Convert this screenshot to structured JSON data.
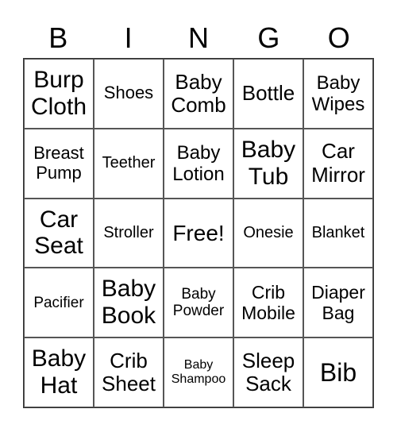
{
  "header": [
    "B",
    "I",
    "N",
    "G",
    "O"
  ],
  "cells": [
    "Burp\nCloth",
    "Shoes",
    "Baby\nComb",
    "Bottle",
    "Baby\nWipes",
    "Breast\nPump",
    "Teether",
    "Baby\nLotion",
    "Baby\nTub",
    "Car\nMirror",
    "Car\nSeat",
    "Stroller",
    "Free!",
    "Onesie",
    "Blanket",
    "Pacifier",
    "Baby\nBook",
    "Baby\nPowder",
    "Crib\nMobile",
    "Diaper\nBag",
    "Baby\nHat",
    "Crib\nSheet",
    "Baby\nShampoo",
    "Sleep\nSack",
    "Bib"
  ]
}
